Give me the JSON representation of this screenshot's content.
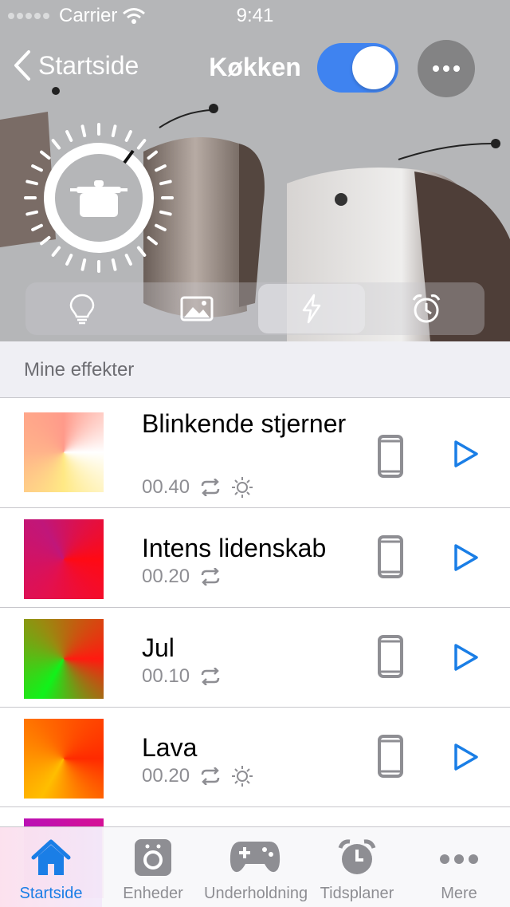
{
  "status": {
    "carrier": "Carrier",
    "time": "9:41"
  },
  "nav": {
    "back_label": "Startside",
    "title": "Køkken",
    "power_on": true
  },
  "mode_tabs": [
    {
      "icon": "lightbulb-icon"
    },
    {
      "icon": "image-icon"
    },
    {
      "icon": "bolt-icon",
      "active": true
    },
    {
      "icon": "alarm-clock-icon"
    }
  ],
  "section": {
    "title": "Mine effekter"
  },
  "effects": [
    {
      "name": "Blinkende stjerner",
      "duration": "00.40",
      "repeat": true,
      "brightness": true,
      "colors": [
        "#ffffff",
        "#ffe985",
        "#ffb38a",
        "#ff9a8a"
      ]
    },
    {
      "name": "Intens lidenskab",
      "duration": "00.20",
      "repeat": true,
      "brightness": false,
      "colors": [
        "#ff0a14",
        "#e21050",
        "#c0167a"
      ]
    },
    {
      "name": "Jul",
      "duration": "00.10",
      "repeat": true,
      "brightness": false,
      "colors": [
        "#ff1a10",
        "#11f21a",
        "#9a8a10"
      ]
    },
    {
      "name": "Lava",
      "duration": "00.20",
      "repeat": true,
      "brightness": true,
      "colors": [
        "#ff2a00",
        "#ffbe00",
        "#ff6a00"
      ]
    },
    {
      "name": "",
      "duration": "",
      "repeat": false,
      "brightness": false,
      "colors": [
        "#e0108a",
        "#b010c0"
      ]
    }
  ],
  "tabbar": {
    "items": [
      {
        "label": "Startside",
        "icon": "home-icon",
        "active": true
      },
      {
        "label": "Enheder",
        "icon": "device-icon"
      },
      {
        "label": "Underholdning",
        "icon": "gamepad-icon"
      },
      {
        "label": "Tidsplaner",
        "icon": "alarm-clock-icon"
      },
      {
        "label": "Mere",
        "icon": "more-dots-icon"
      }
    ]
  },
  "colors": {
    "accent": "#1a7ee6",
    "toggle": "#3f83f0",
    "secondary_text": "#8e8e93",
    "separator": "#c8c7cc"
  }
}
